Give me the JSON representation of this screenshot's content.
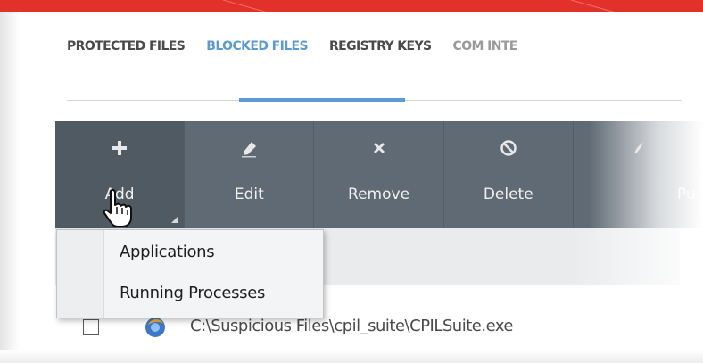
{
  "tabs": [
    {
      "label": "PROTECTED FILES",
      "active": false
    },
    {
      "label": "BLOCKED FILES",
      "active": true
    },
    {
      "label": "REGISTRY KEYS",
      "active": false
    },
    {
      "label": "COM INTE",
      "active": false
    }
  ],
  "toolbar": {
    "buttons": [
      {
        "label": "Add",
        "icon": "plus-icon"
      },
      {
        "label": "Edit",
        "icon": "pencil-icon"
      },
      {
        "label": "Remove",
        "icon": "x-icon"
      },
      {
        "label": "Delete",
        "icon": "no-entry-icon"
      },
      {
        "label": "Pu",
        "icon": "purge-icon"
      }
    ]
  },
  "dropdown": {
    "items": [
      "Applications",
      "Running Processes"
    ]
  },
  "rows": [
    {
      "path": "C:\\Suspicious Files\\cpil_suite\\CPILSuite.exe",
      "checked": false
    }
  ],
  "colors": {
    "accent": "#5b9bd5",
    "toolbar": "#5f6a74",
    "banner": "#e2312a"
  }
}
